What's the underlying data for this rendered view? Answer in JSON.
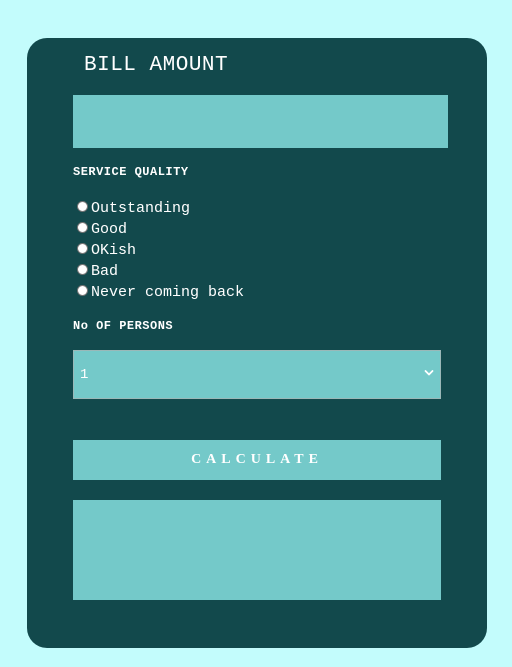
{
  "form": {
    "title": "BILL AMOUNT",
    "bill_value": "",
    "service_label": "SERVICE QUALITY",
    "service_options": [
      "Outstanding",
      "Good",
      "OKish",
      "Bad",
      "Never coming back"
    ],
    "persons_label": "No OF PERSONS",
    "persons_selected": "1",
    "calculate_label": "CALCULATE",
    "result_text": ""
  },
  "colors": {
    "page_background": "#c3fcfc",
    "card_background": "#12494c",
    "field_background": "#74c9c9",
    "text": "#ffffff"
  }
}
